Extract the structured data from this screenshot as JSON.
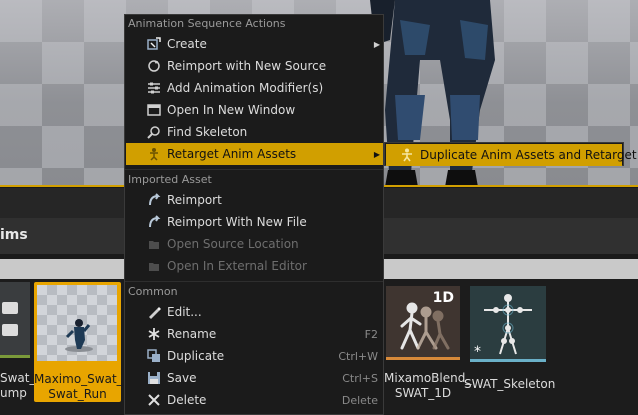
{
  "menu": {
    "sections": {
      "animation": "Animation Sequence Actions",
      "imported": "Imported Asset",
      "common": "Common"
    },
    "animation_items": [
      {
        "label": "Create",
        "icon": "create-icon",
        "submenu": true
      },
      {
        "label": "Reimport with New Source",
        "icon": "reimport-source-icon"
      },
      {
        "label": "Add Animation Modifier(s)",
        "icon": "modifier-icon"
      },
      {
        "label": "Open In New Window",
        "icon": "window-icon"
      },
      {
        "label": "Find Skeleton",
        "icon": "search-icon"
      },
      {
        "label": "Retarget Anim Assets",
        "icon": "retarget-icon",
        "submenu": true,
        "highlighted": true
      }
    ],
    "imported_items": [
      {
        "label": "Reimport",
        "icon": "reimport-icon"
      },
      {
        "label": "Reimport With New File",
        "icon": "reimport-file-icon"
      },
      {
        "label": "Open Source Location",
        "icon": "source-location-icon",
        "disabled": true
      },
      {
        "label": "Open In External Editor",
        "icon": "external-editor-icon",
        "disabled": true
      }
    ],
    "common_items": [
      {
        "label": "Edit...",
        "icon": "edit-icon"
      },
      {
        "label": "Rename",
        "icon": "rename-icon",
        "shortcut": "F2"
      },
      {
        "label": "Duplicate",
        "icon": "duplicate-icon",
        "shortcut": "Ctrl+W"
      },
      {
        "label": "Save",
        "icon": "save-icon",
        "shortcut": "Ctrl+S"
      },
      {
        "label": "Delete",
        "icon": "delete-icon",
        "shortcut": "Delete"
      }
    ]
  },
  "submenu": {
    "item": {
      "label": "Duplicate Anim Assets and Retarget",
      "icon": "retarget-figure-icon"
    }
  },
  "content_browser": {
    "folder_title": "ims",
    "assets": [
      {
        "label_line1": "Swat_",
        "label_line2": "ump"
      },
      {
        "label_line1": "Maximo_Swat_",
        "label_line2": "Swat_Run",
        "selected": true
      },
      {
        "label_line1": "MixamoBlend_",
        "label_line2": "SWAT_1D",
        "badge": "1D"
      },
      {
        "label_line1": "SWAT_Skeleton",
        "label_line2": ""
      }
    ]
  },
  "colors": {
    "accent": "#d19f00",
    "selection": "#e8a500",
    "menu_bg": "#1b1b1b"
  }
}
